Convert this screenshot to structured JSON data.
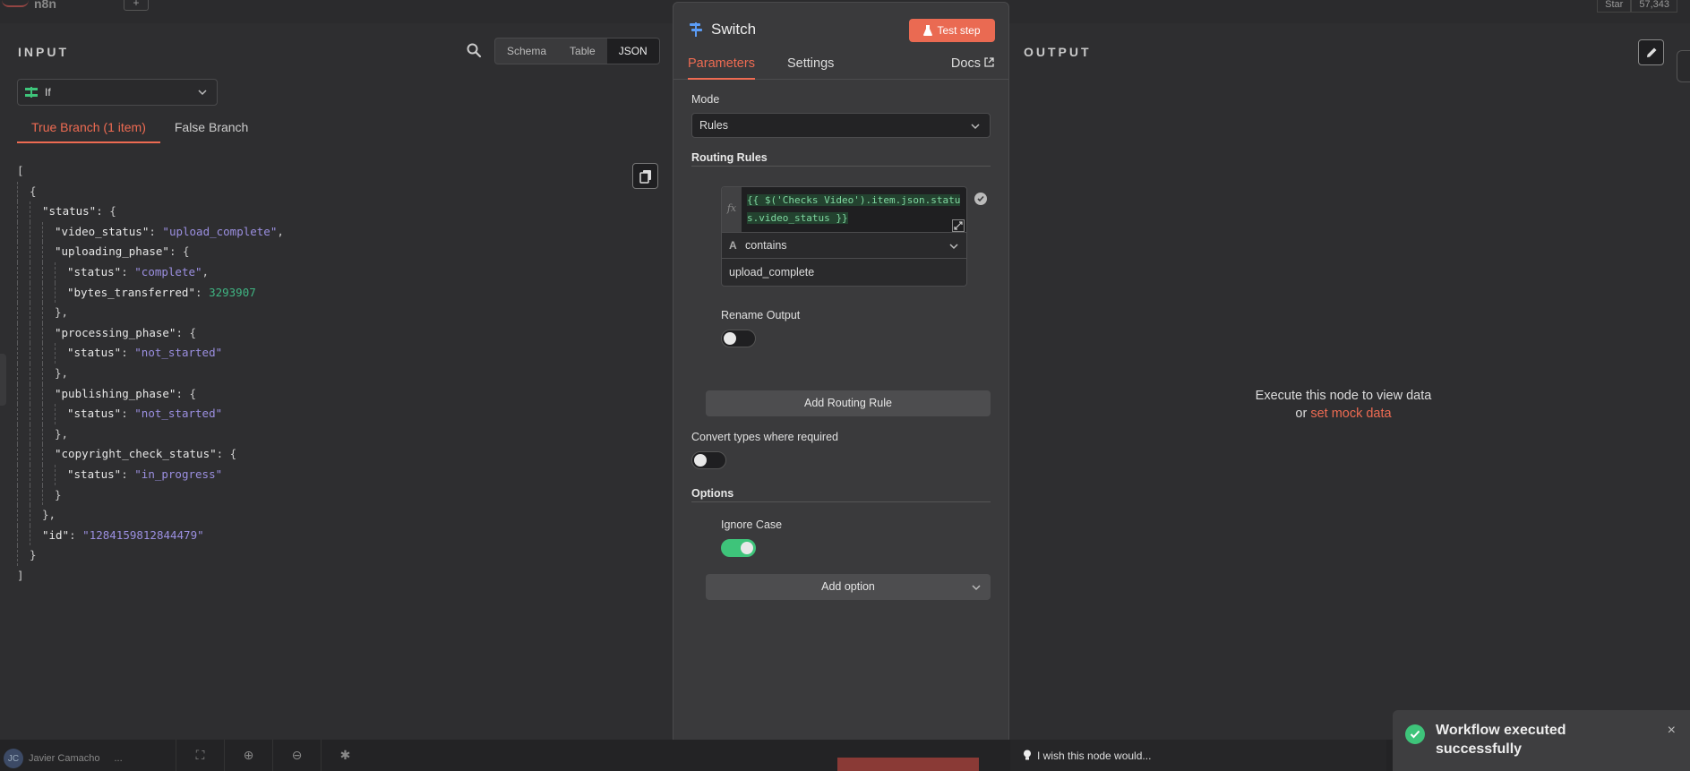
{
  "topbar": {
    "logo": "n8n",
    "add_label": "+",
    "star_label": "Star",
    "star_count": "57,343"
  },
  "input_panel": {
    "title": "INPUT",
    "views": [
      "Schema",
      "Table",
      "JSON"
    ],
    "active_view": "JSON",
    "node_select": "If",
    "branches": [
      "True Branch (1 item)",
      "False Branch"
    ]
  },
  "json_lines": [
    {
      "d": 0,
      "t": [
        [
          "p",
          "["
        ]
      ]
    },
    {
      "d": 1,
      "t": [
        [
          "p",
          "{"
        ]
      ]
    },
    {
      "d": 2,
      "t": [
        [
          "k",
          "\"status\""
        ],
        [
          "p",
          ": {"
        ]
      ]
    },
    {
      "d": 3,
      "t": [
        [
          "k",
          "\"video_status\""
        ],
        [
          "p",
          ": "
        ],
        [
          "s",
          "\"upload_complete\""
        ],
        [
          "p",
          ","
        ]
      ]
    },
    {
      "d": 3,
      "t": [
        [
          "k",
          "\"uploading_phase\""
        ],
        [
          "p",
          ": {"
        ]
      ]
    },
    {
      "d": 4,
      "t": [
        [
          "k",
          "\"status\""
        ],
        [
          "p",
          ": "
        ],
        [
          "s",
          "\"complete\""
        ],
        [
          "p",
          ","
        ]
      ]
    },
    {
      "d": 4,
      "t": [
        [
          "k",
          "\"bytes_transferred\""
        ],
        [
          "p",
          ": "
        ],
        [
          "n",
          "3293907"
        ]
      ]
    },
    {
      "d": 3,
      "t": [
        [
          "p",
          "},"
        ]
      ]
    },
    {
      "d": 3,
      "t": [
        [
          "k",
          "\"processing_phase\""
        ],
        [
          "p",
          ": {"
        ]
      ]
    },
    {
      "d": 4,
      "t": [
        [
          "k",
          "\"status\""
        ],
        [
          "p",
          ": "
        ],
        [
          "s",
          "\"not_started\""
        ]
      ]
    },
    {
      "d": 3,
      "t": [
        [
          "p",
          "},"
        ]
      ]
    },
    {
      "d": 3,
      "t": [
        [
          "k",
          "\"publishing_phase\""
        ],
        [
          "p",
          ": {"
        ]
      ]
    },
    {
      "d": 4,
      "t": [
        [
          "k",
          "\"status\""
        ],
        [
          "p",
          ": "
        ],
        [
          "s",
          "\"not_started\""
        ]
      ]
    },
    {
      "d": 3,
      "t": [
        [
          "p",
          "},"
        ]
      ]
    },
    {
      "d": 3,
      "t": [
        [
          "k",
          "\"copyright_check_status\""
        ],
        [
          "p",
          ": {"
        ]
      ]
    },
    {
      "d": 4,
      "t": [
        [
          "k",
          "\"status\""
        ],
        [
          "p",
          ": "
        ],
        [
          "s",
          "\"in_progress\""
        ]
      ]
    },
    {
      "d": 3,
      "t": [
        [
          "p",
          "}"
        ]
      ]
    },
    {
      "d": 2,
      "t": [
        [
          "p",
          "},"
        ]
      ]
    },
    {
      "d": 2,
      "t": [
        [
          "k",
          "\"id\""
        ],
        [
          "p",
          ": "
        ],
        [
          "s",
          "\"1284159812844479\""
        ]
      ]
    },
    {
      "d": 1,
      "t": [
        [
          "p",
          "}"
        ]
      ]
    },
    {
      "d": 0,
      "t": [
        [
          "p",
          "]"
        ]
      ]
    }
  ],
  "switch_panel": {
    "title": "Switch",
    "test_button": "Test step",
    "tabs": [
      "Parameters",
      "Settings"
    ],
    "docs_label": "Docs",
    "mode_label": "Mode",
    "mode_value": "Rules",
    "routing_rules_label": "Routing Rules",
    "rule": {
      "expression": "{{ $('Checks Video').item.json.status.video_status }}",
      "operator": "contains",
      "value": "upload_complete"
    },
    "rename_output_label": "Rename Output",
    "rename_output_on": false,
    "add_rule_button": "Add Routing Rule",
    "convert_types_label": "Convert types where required",
    "convert_types_on": false,
    "options_label": "Options",
    "ignore_case_label": "Ignore Case",
    "ignore_case_on": true,
    "add_option_button": "Add option"
  },
  "output_panel": {
    "title": "OUTPUT",
    "empty_line1": "Execute this node to view data",
    "empty_or": "or",
    "mock_link": "set mock data"
  },
  "bottombar": {
    "user_initials": "JC",
    "user_name": "Javier Camacho",
    "more": "...",
    "wish_text": "I wish this node would..."
  },
  "toast": {
    "message": "Workflow executed successfully",
    "close": "×"
  },
  "colors": {
    "accent": "#ee6b52",
    "success": "#3ec47a",
    "json_string": "#9b8fe0",
    "json_number": "#3fb482"
  }
}
